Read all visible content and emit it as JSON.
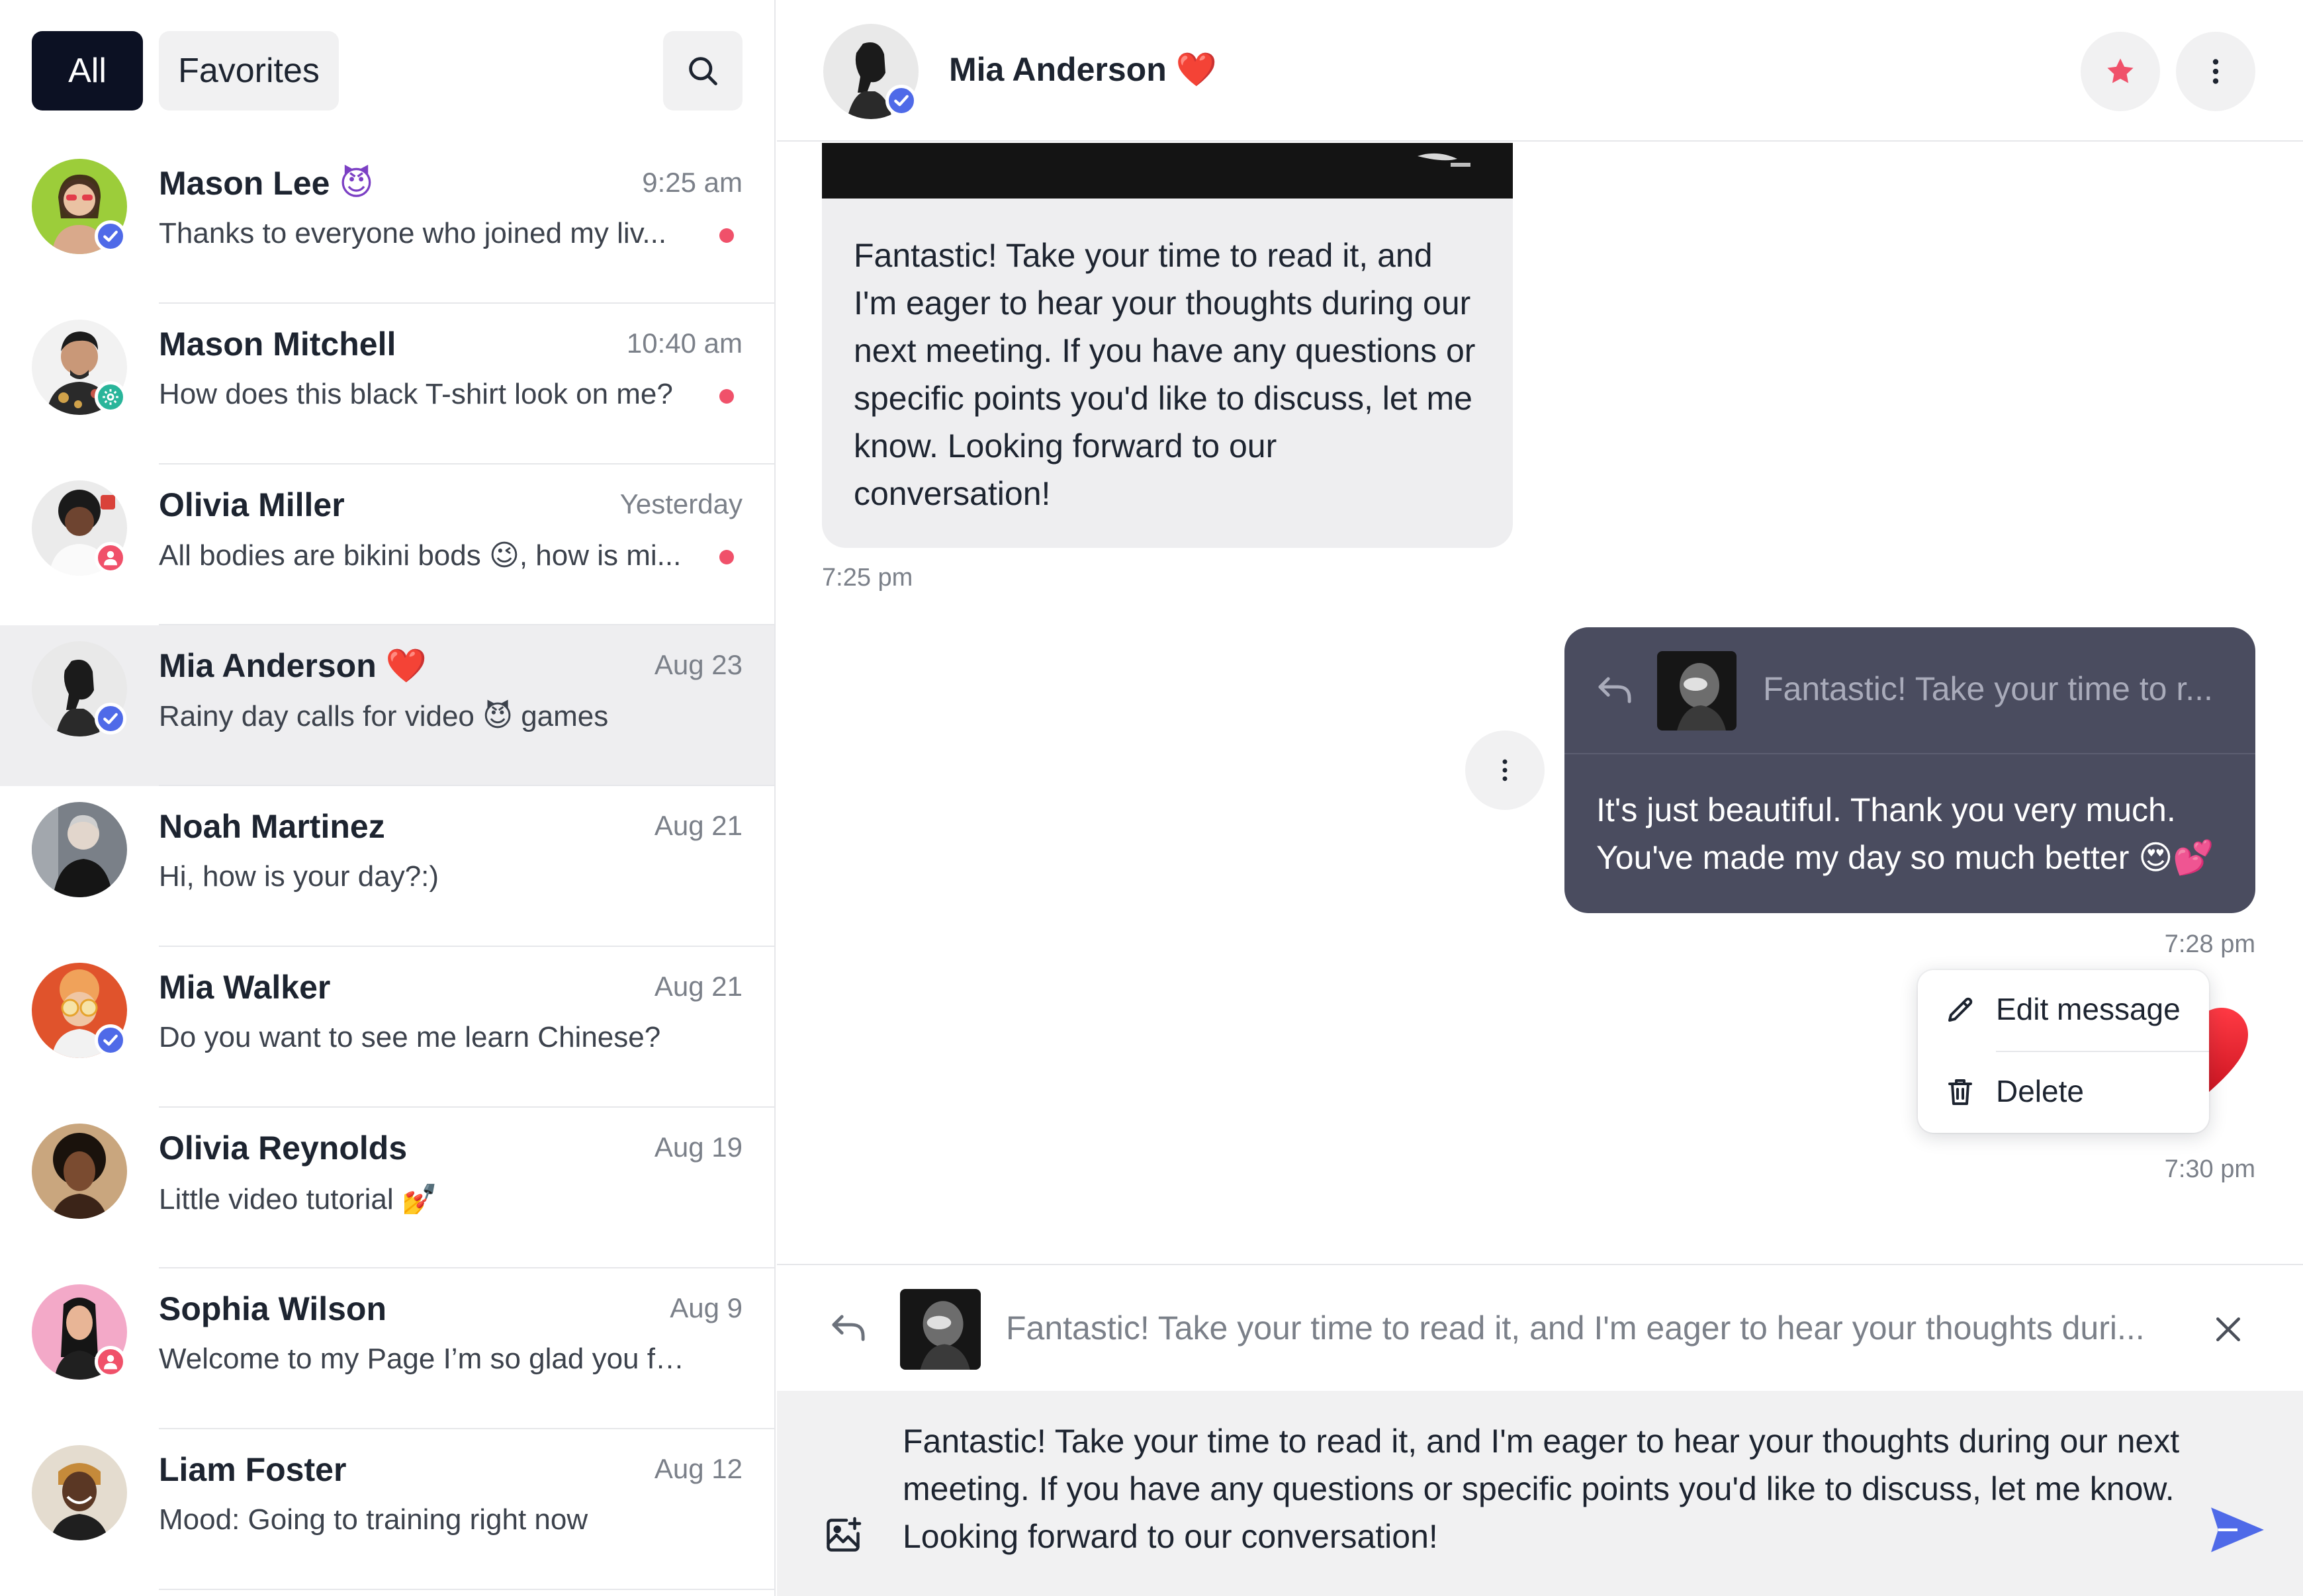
{
  "tabs": {
    "all": "All",
    "favorites": "Favorites"
  },
  "conversations": [
    {
      "name": "Mason Lee",
      "emoji": "😈",
      "time": "9:25 am",
      "preview": "Thanks to everyone who joined my liv...",
      "unread": true,
      "badge": "verified"
    },
    {
      "name": "Mason Mitchell",
      "emoji": "",
      "time": "10:40 am",
      "preview": "How does this black T-shirt look on me?",
      "unread": true,
      "badge": "settings"
    },
    {
      "name": "Olivia Miller",
      "emoji": "",
      "time": "Yesterday",
      "preview": "All bodies are bikini bods 😉, how is mi...",
      "unread": true,
      "badge": "user"
    },
    {
      "name": "Mia Anderson",
      "emoji": "❤️",
      "time": "Aug 23",
      "preview": "Rainy day calls for video 😈 games",
      "unread": false,
      "badge": "verified",
      "active": true
    },
    {
      "name": "Noah Martinez",
      "emoji": "",
      "time": "Aug 21",
      "preview": "Hi, how is your day?:)",
      "unread": false,
      "badge": ""
    },
    {
      "name": "Mia Walker",
      "emoji": "",
      "time": "Aug 21",
      "preview": "Do you want to see me learn Chinese?",
      "unread": false,
      "badge": "verified"
    },
    {
      "name": "Olivia Reynolds",
      "emoji": "",
      "time": "Aug 19",
      "preview": "Little video tutorial 💅",
      "unread": false,
      "badge": ""
    },
    {
      "name": "Sophia Wilson",
      "emoji": "",
      "time": "Aug 9",
      "preview": "Welcome to my Page I’m so glad you found...",
      "unread": false,
      "badge": "user"
    },
    {
      "name": "Liam Foster",
      "emoji": "",
      "time": "Aug 12",
      "preview": "Mood: Going to training right now",
      "unread": false,
      "badge": ""
    }
  ],
  "chat": {
    "contact_name": "Mia Anderson",
    "contact_emoji": "❤️",
    "messages": {
      "incoming_text": "Fantastic! Take your time to read it, and I'm eager to hear your thoughts during our next meeting. If you have any questions or specific points you'd like to discuss, let me know. Looking forward to our conversation!",
      "incoming_time": "7:25 pm",
      "outgoing_reply_ref": "Fantastic! Take your time to r...",
      "outgoing_text": "It's just beautiful. Thank you very much. You've made my day so much better 😍💕",
      "outgoing_time": "7:28 pm",
      "heart_emoji": "❤️",
      "heart_time": "7:30 pm"
    },
    "context_menu": {
      "edit": "Edit message",
      "delete": "Delete"
    },
    "reply_bar": {
      "text": "Fantastic! Take your time to read it, and I'm eager to hear your thoughts duri..."
    },
    "composer": {
      "text": "Fantastic! Take your time to read it, and I'm eager to hear your thoughts during our next meeting. If you have any questions or specific points you'd like to discuss, let me know. Looking forward to our conversation!"
    }
  },
  "icons": [
    "search-icon",
    "star-icon",
    "more-vertical-icon",
    "reply-icon",
    "edit-icon",
    "trash-icon",
    "close-icon",
    "image-add-icon",
    "send-icon",
    "verified-icon",
    "settings-icon",
    "user-icon"
  ],
  "colors": {
    "dark_tab": "#0c1123",
    "unread": "#f0516a",
    "verified": "#4f6ae8",
    "settings_badge": "#29b59a",
    "user_badge": "#f0516a",
    "outgoing_bubble": "#4a4c5f",
    "send": "#4f6ae8"
  }
}
